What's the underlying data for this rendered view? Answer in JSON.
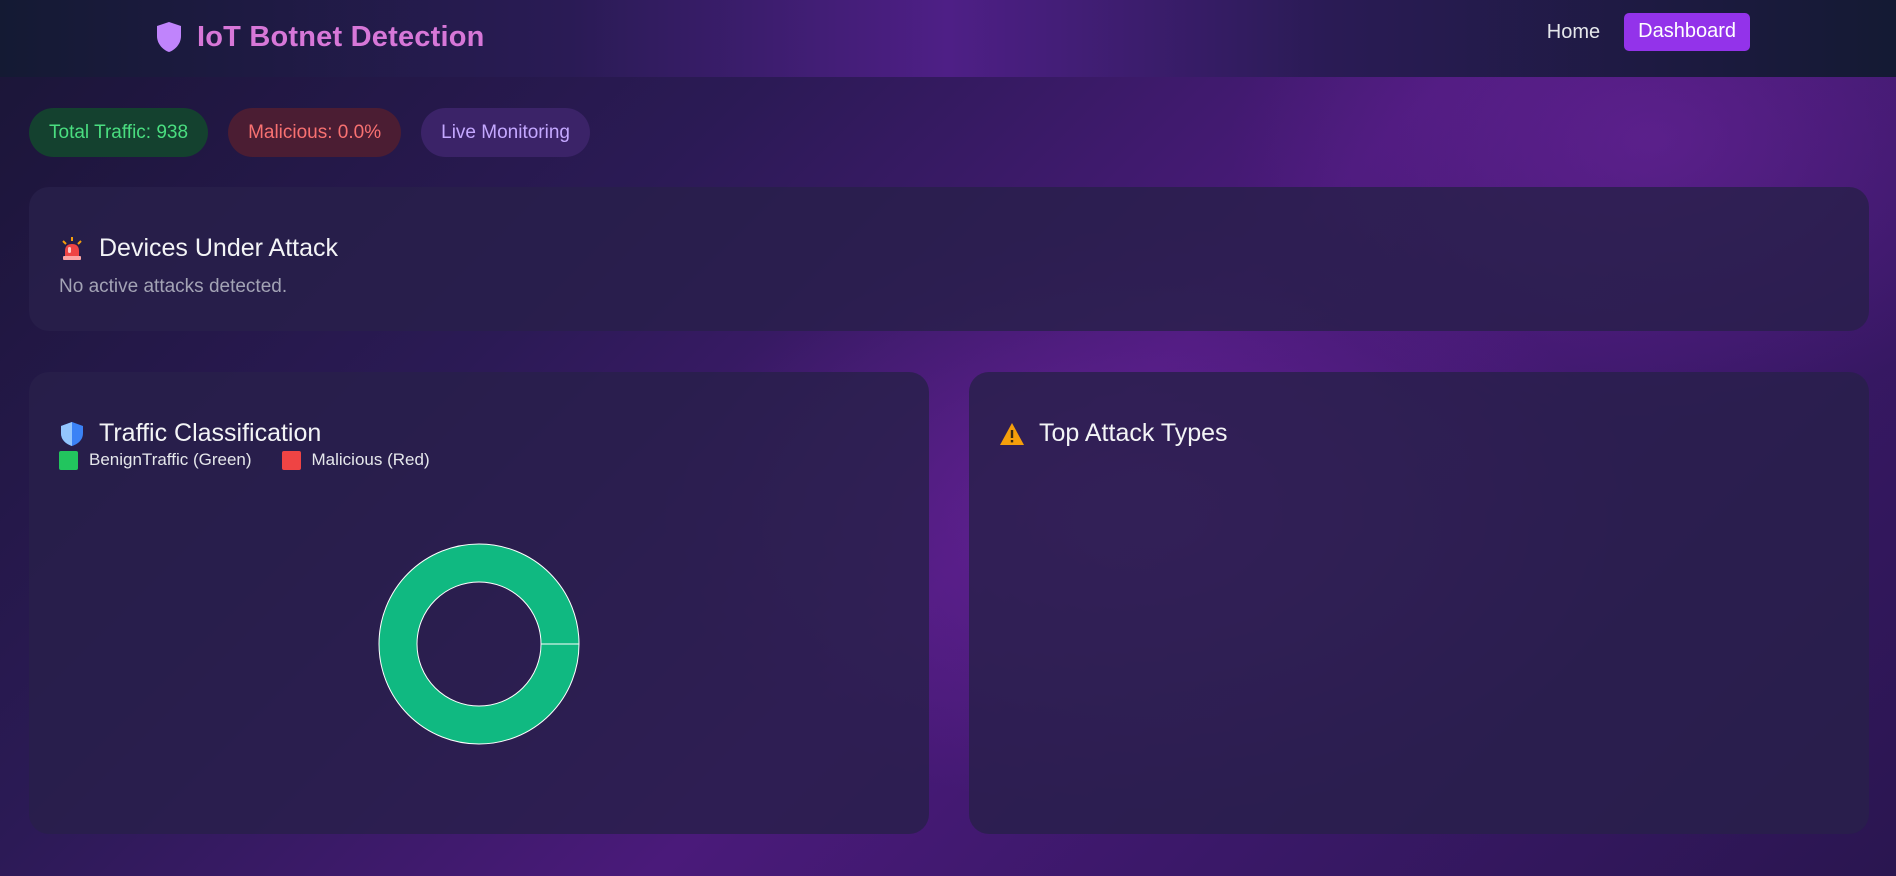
{
  "header": {
    "title": "IoT Botnet Detection",
    "nav": {
      "home": "Home",
      "dashboard": "Dashboard"
    }
  },
  "stats": {
    "total_traffic": "Total Traffic: 938",
    "malicious": "Malicious: 0.0%",
    "live": "Live Monitoring"
  },
  "attacks_card": {
    "title": "Devices Under Attack",
    "empty_message": "No active attacks detected."
  },
  "traffic_card": {
    "title": "Traffic Classification",
    "legend": [
      {
        "label": "BenignTraffic (Green)",
        "color": "#22c55e"
      },
      {
        "label": "Malicious (Red)",
        "color": "#ef4444"
      }
    ]
  },
  "types_card": {
    "title": "Top Attack Types"
  },
  "chart_data": {
    "type": "pie",
    "categories": [
      "BenignTraffic",
      "Malicious"
    ],
    "values": [
      100,
      0
    ],
    "colors": [
      "#10b981",
      "#ef4444"
    ],
    "title": ""
  },
  "colors": {
    "accent": "#9333ea",
    "brand": "#d777d8",
    "benign": "#10b981",
    "malicious": "#ef4444"
  }
}
